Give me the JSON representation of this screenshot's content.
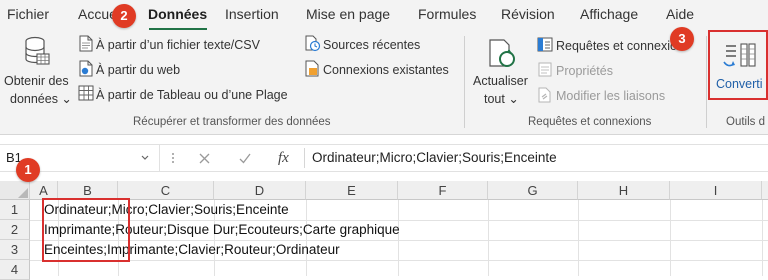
{
  "tabs": [
    "Fichier",
    "Accueil",
    "Données",
    "Insertion",
    "Mise en page",
    "Formules",
    "Révision",
    "Affichage",
    "Aide"
  ],
  "ribbon": {
    "get_data": {
      "line1": "Obtenir des",
      "line2": "données ⌄"
    },
    "from_text": "À partir d’un fichier texte/CSV",
    "from_web": "À partir du web",
    "from_table": "À partir de Tableau ou d’une Plage",
    "recent_sources": "Sources récentes",
    "existing_connections": "Connexions existantes",
    "group1_label": "Récupérer et transformer des données",
    "refresh": {
      "line1": "Actualiser",
      "line2": "tout ⌄"
    },
    "queries": "Requêtes et connexio",
    "properties": "Propriétés",
    "edit_links": "Modifier les liaisons",
    "group2_label": "Requêtes et connexions",
    "convert": "Converti",
    "group3_label": "Outils d"
  },
  "badges": [
    "1",
    "2",
    "3"
  ],
  "formula_bar": {
    "name_box": "B1",
    "fx": "fx",
    "formula": "Ordinateur;Micro;Clavier;Souris;Enceinte"
  },
  "grid": {
    "columns": [
      "A",
      "B",
      "C",
      "D",
      "E",
      "F",
      "G",
      "H",
      "I"
    ],
    "rows": [
      "1",
      "2",
      "3",
      "4"
    ],
    "cells": [
      "Ordinateur;Micro;Clavier;Souris;Enceinte",
      "Imprimante;Routeur;Disque Dur;Ecouteurs;Carte graphique",
      "Enceintes;Imprimante;Clavier;Routeur;Ordinateur"
    ]
  },
  "colors": {
    "accent": "#217346",
    "highlight": "#d9302f",
    "badge": "#e03b24"
  }
}
